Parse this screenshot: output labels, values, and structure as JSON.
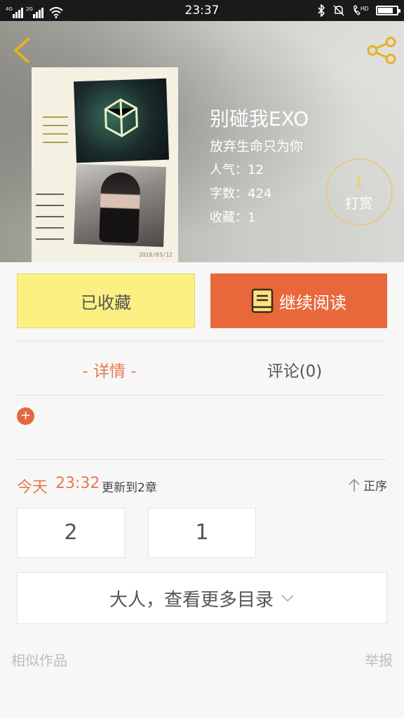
{
  "status_bar": {
    "net1": "4G",
    "net2": "2G",
    "time": "23:37",
    "battery_level": 0.8
  },
  "book": {
    "title": "别碰我EXO",
    "subtitle": "放弃生命只为你",
    "popularity_label": "人气：",
    "popularity": "12",
    "word_count_label": "字数：",
    "word_count": "424",
    "favorites_label": "收藏：",
    "favorites": "1",
    "cover_date": "2018/03/12"
  },
  "reward": {
    "count": "1",
    "label": "打赏"
  },
  "actions": {
    "favorited_label": "已收藏",
    "continue_label": "继续阅读"
  },
  "tabs": {
    "detail": "- 详情 -",
    "comment": "评论(0)"
  },
  "detail": {
    "expand_symbol": "+"
  },
  "update": {
    "today": "今天",
    "time": "23:32",
    "text": "更新到2章",
    "order": "正序"
  },
  "chapters": [
    "2",
    "1"
  ],
  "more_catalog": "大人，查看更多目录",
  "footer": {
    "similar": "相似作品",
    "report": "举报"
  },
  "colors": {
    "accent": "#e8683c",
    "favorite_bg": "#fbf081",
    "reward_count": "#f1cf5b"
  },
  "icons": [
    "back-arrow-icon",
    "share-icon",
    "book-icon",
    "up-arrow-icon",
    "chevron-down-icon",
    "bluetooth-icon",
    "bell-mute-icon",
    "hd-call-icon",
    "battery-icon",
    "wifi-icon"
  ]
}
